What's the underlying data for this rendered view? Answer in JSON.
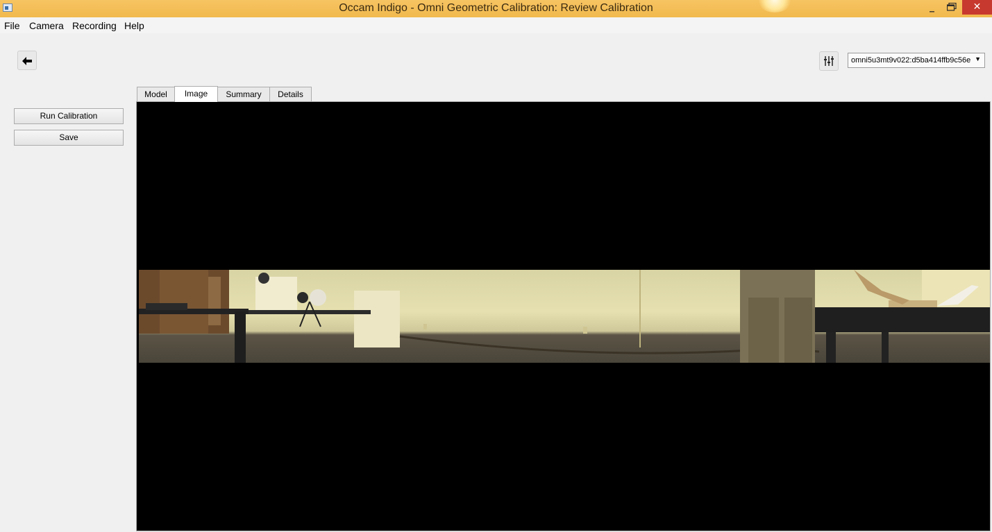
{
  "window": {
    "title": "Occam Indigo - Omni Geometric Calibration: Review Calibration"
  },
  "menu": [
    "File",
    "Camera",
    "Recording",
    "Help"
  ],
  "toolbar": {
    "back_icon": "arrow-left-icon",
    "settings_icon": "sliders-icon",
    "device": "omni5u3mt9v022:d5ba414ffb9c56e"
  },
  "actions": {
    "run_calibration": "Run Calibration",
    "save": "Save"
  },
  "tabs": {
    "model": "Model",
    "image": "Image",
    "summary": "Summary",
    "details": "Details",
    "active": "Image"
  }
}
